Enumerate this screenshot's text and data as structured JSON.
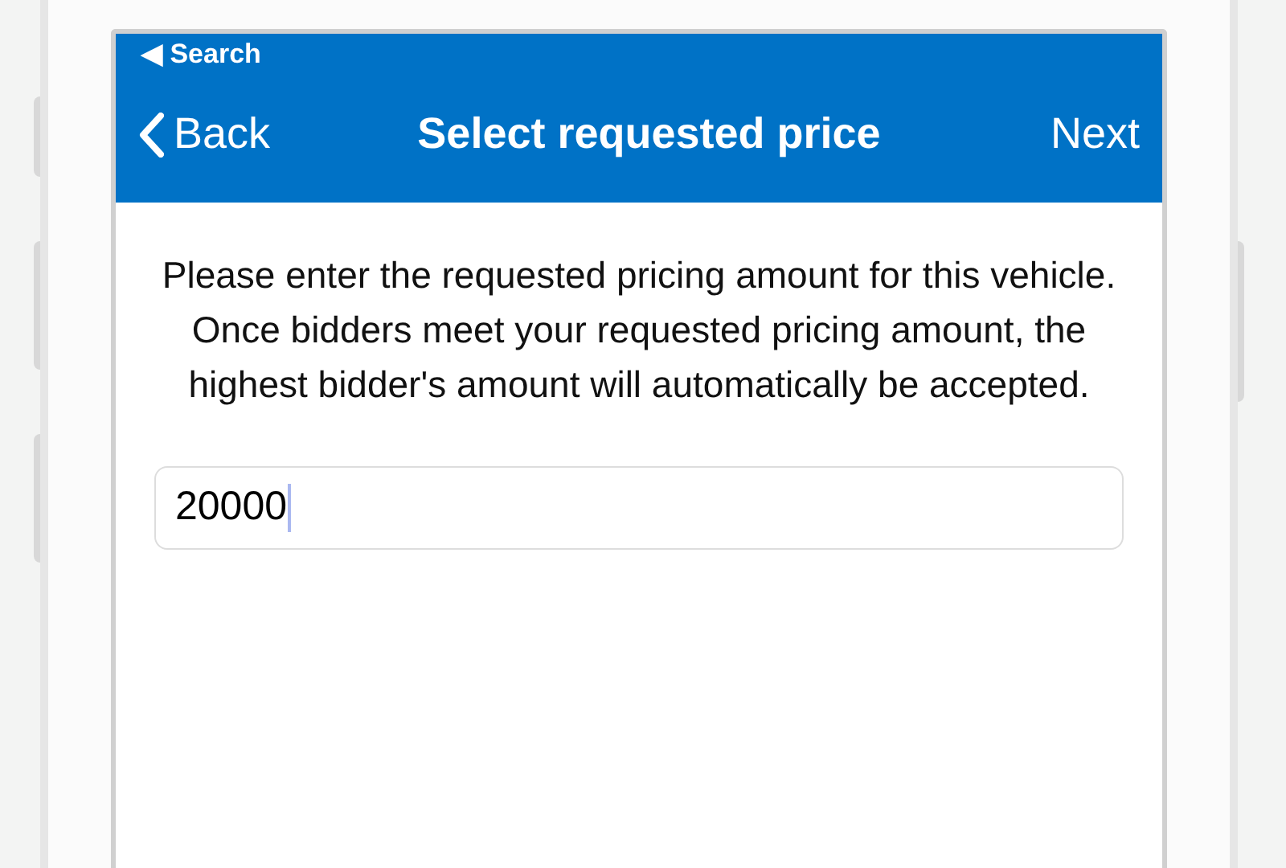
{
  "status_bar": {
    "back_app": "◀ Search"
  },
  "nav_bar": {
    "back": "Back",
    "title": "Select requested price",
    "next": "Next"
  },
  "instructions": "Please enter the requested pricing amount for this vehicle. Once bidders meet your requested pricing amount, the highest bidder's amount will automatically be accepted.",
  "price_field": {
    "value": "20000",
    "focused": true
  }
}
